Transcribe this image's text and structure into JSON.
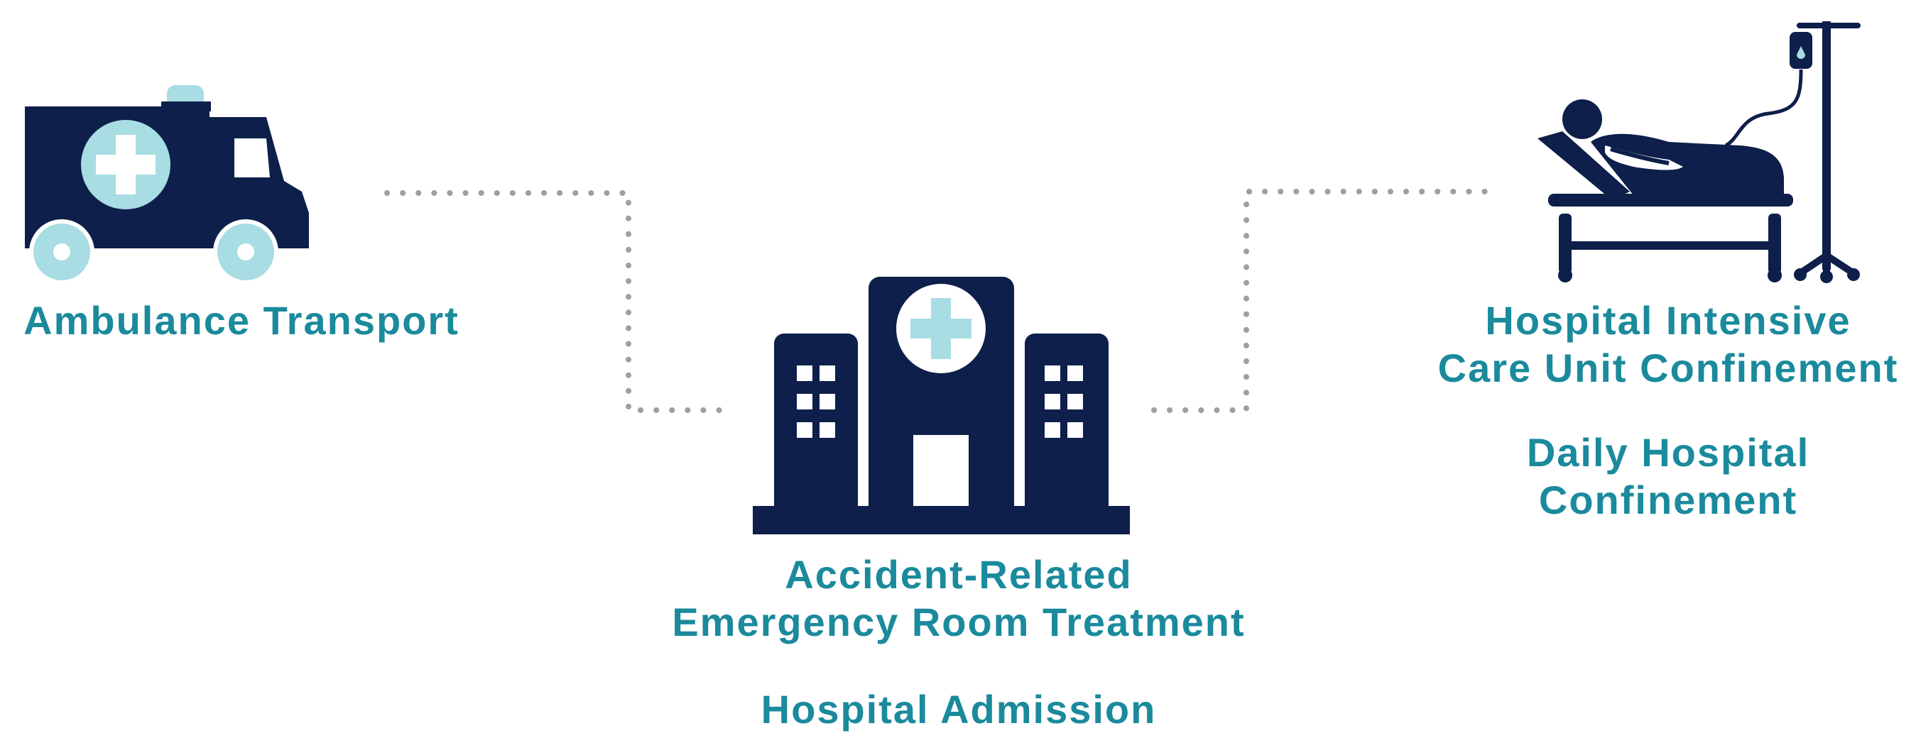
{
  "stages": [
    {
      "id": "ambulance",
      "icon": "ambulance-icon",
      "labels": [
        "Ambulance Transport"
      ]
    },
    {
      "id": "emergency-room",
      "icon": "hospital-building-icon",
      "labels": [
        "Accident-Related\nEmergency Room Treatment",
        "Hospital Admission"
      ]
    },
    {
      "id": "icu",
      "icon": "hospital-bed-patient-icon",
      "labels": [
        "Hospital Intensive\nCare Unit Confinement",
        "Daily Hospital\nConfinement"
      ]
    }
  ],
  "colors": {
    "icon_primary": "#0d1f4a",
    "icon_accent": "#a8dde3",
    "label_text": "#1a8a9c",
    "connector": "#9aa0a6"
  }
}
